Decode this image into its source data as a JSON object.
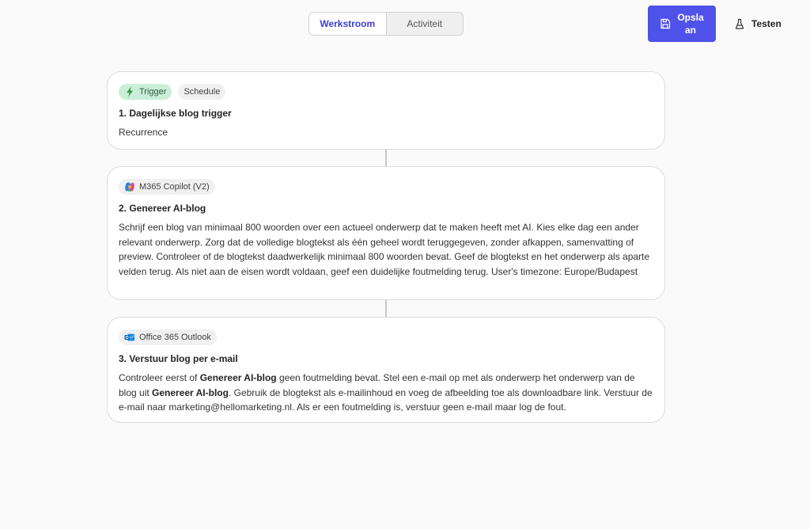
{
  "tabs": [
    {
      "label": "Werkstroom",
      "active": true
    },
    {
      "label": "Activiteit",
      "active": false
    }
  ],
  "actions": {
    "save_label": "Opslaan",
    "test_label": "Testen"
  },
  "colors": {
    "accent": "#4f52e8",
    "trigger_badge": "#cbeed9"
  },
  "steps": [
    {
      "badges": [
        {
          "label": "Trigger",
          "icon": "lightning-bolt-icon"
        },
        {
          "label": "Schedule"
        }
      ],
      "title": "1. Dagelijkse blog trigger",
      "body": "Recurrence"
    },
    {
      "badges": [
        {
          "label": "M365 Copilot (V2)",
          "icon": "copilot-icon"
        }
      ],
      "title": "2. Genereer AI-blog",
      "body": "Schrijf een blog van minimaal 800 woorden over een actueel onderwerp dat te maken heeft met AI. Kies elke dag een ander relevant onderwerp. Zorg dat de volledige blogtekst als één geheel wordt teruggegeven, zonder afkappen, samenvatting of preview. Controleer of de blogtekst daadwerkelijk minimaal 800 woorden bevat. Geef de blogtekst en het onderwerp als aparte velden terug. Als niet aan de eisen wordt voldaan, geef een duidelijke foutmelding terug. User's timezone: Europe/Budapest"
    },
    {
      "badges": [
        {
          "label": "Office 365 Outlook",
          "icon": "outlook-icon"
        }
      ],
      "title": "3. Verstuur blog per e-mail",
      "body_parts": [
        {
          "text": "Controleer eerst of ",
          "bold": false
        },
        {
          "text": "Genereer AI-blog",
          "bold": true
        },
        {
          "text": " geen foutmelding bevat. Stel een e-mail op met als onderwerp het onderwerp van de blog uit ",
          "bold": false
        },
        {
          "text": "Genereer AI-blog",
          "bold": true
        },
        {
          "text": ". Gebruik de blogtekst als e-mailinhoud en voeg de afbeelding toe als downloadbare link. Verstuur de e-mail naar marketing@hellomarketing.nl. Als er een foutmelding is, verstuur geen e-mail maar log de fout.",
          "bold": false
        }
      ]
    }
  ]
}
